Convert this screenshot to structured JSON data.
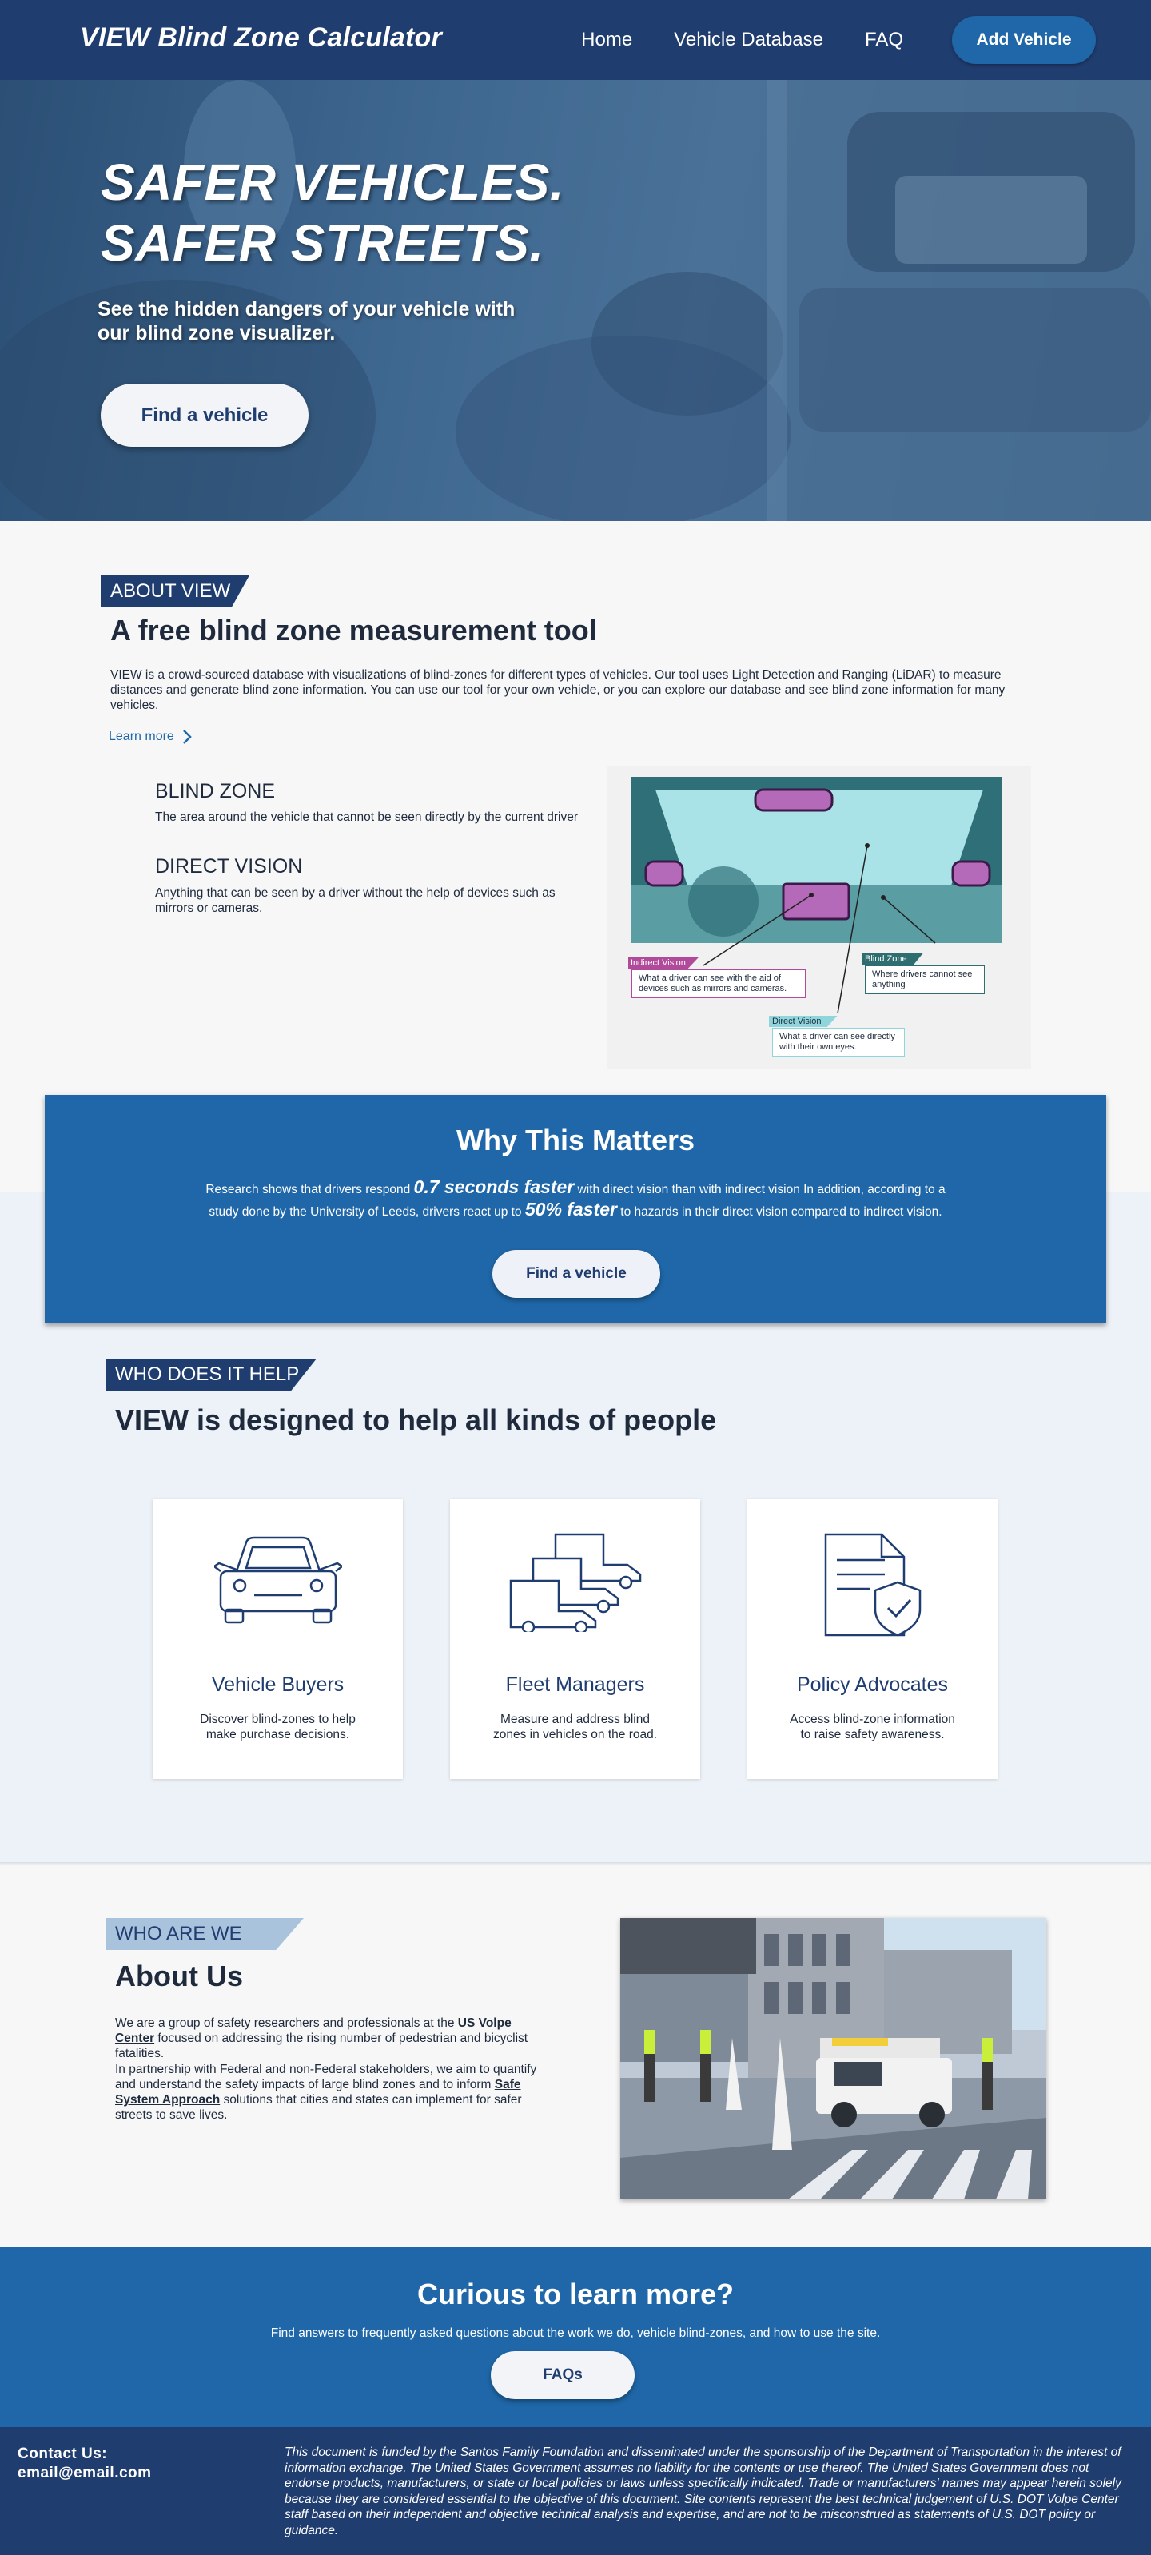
{
  "nav": {
    "brand": "VIEW Blind Zone Calculator",
    "links": [
      "Home",
      "Vehicle Database",
      "FAQ"
    ],
    "add_button": "Add Vehicle"
  },
  "hero": {
    "title_line1": "SAFER VEHICLES.",
    "title_line2": "SAFER STREETS.",
    "subtitle": "See the hidden dangers of your vehicle  with our blind zone visualizer.",
    "button": "Find a vehicle"
  },
  "about_view": {
    "tag": "ABOUT VIEW",
    "title": "A free blind zone measurement tool",
    "text": "VIEW is a crowd-sourced database with visualizations of blind-zones for different types of vehicles. Our tool uses Light Detection and Ranging (LiDAR) to measure distances and generate blind zone information. You can use our tool for your own vehicle, or you can explore our database and see blind zone information for many vehicles.",
    "learn_more": "Learn more",
    "blind_zone_heading": "BLIND ZONE",
    "blind_zone_text": "The area around the vehicle that cannot be seen directly by the current driver",
    "direct_vision_heading": "DIRECT VISION",
    "direct_vision_text": "Anything that can be seen by a driver without the help of devices such as mirrors or cameras.",
    "diagram": {
      "indirect_label": "Indirect Vision",
      "indirect_text": "What a driver can see with the aid of devices such as mirrors and cameras.",
      "blind_label": "Blind Zone",
      "blind_text": "Where drivers cannot see anything",
      "direct_label": "Direct Vision",
      "direct_text": "What a driver can see directly with their own eyes."
    }
  },
  "why": {
    "title": "Why This Matters",
    "l1_a": "Research shows that drivers respond ",
    "l1_b": "0.7 seconds faster",
    "l1_c": " with direct vision than with indirect vision In addition, according to a",
    "l2_a": "study done by the University of Leeds, drivers react up to ",
    "l2_b": "50% faster",
    "l2_c": " to hazards in their direct vision compared to indirect vision.",
    "button": "Find a vehicle"
  },
  "who_helps": {
    "tag": "WHO DOES IT HELP",
    "title": "VIEW is designed to help all kinds of people",
    "cards": [
      {
        "title": "Vehicle Buyers",
        "text": "Discover blind-zones to help make purchase decisions.",
        "icon": "car-icon"
      },
      {
        "title": "Fleet Managers",
        "text": "Measure and address blind zones in vehicles on the road.",
        "icon": "trucks-icon"
      },
      {
        "title": "Policy Advocates",
        "text": "Access blind-zone information to raise safety awareness.",
        "icon": "document-shield-icon"
      }
    ]
  },
  "about_us": {
    "tag": "WHO ARE WE",
    "title": "About Us",
    "p1_a": "We are a group of safety researchers and professionals at the ",
    "p1_link": "US Volpe Center",
    "p1_b": " focused on addressing the rising number of pedestrian and bicyclist fatalities.",
    "p2_a": "In partnership with Federal and non-Federal stakeholders, we aim to quantify and understand the safety impacts of large blind zones and to inform ",
    "p2_link": "Safe System Approach",
    "p2_b": " solutions that cities and states can implement for safer streets to save lives."
  },
  "curious": {
    "title": "Curious to learn more?",
    "text": "Find answers to frequently asked questions about the work we do, vehicle blind-zones, and how to use the site.",
    "button": "FAQs"
  },
  "footer": {
    "contact_label": "Contact Us:",
    "email": "email@email.com",
    "disclaimer": "This document is funded by the Santos Family Foundation and disseminated under the sponsorship of the Department of Transportation in the interest of information exchange. The United States Government assumes no liability for the contents or use thereof. The United States Government does not endorse products, manufacturers, or state or local policies or laws unless specifically indicated. Trade or manufacturers' names may appear herein solely because they are considered essential to the objective of this document. Site contents represent the best technical judgement of U.S. DOT Volpe Center staff based on their independent and objective technical analysis and expertise, and are not to be misconstrued as statements of U.S. DOT policy or guidance."
  },
  "colors": {
    "nav": "#203d70",
    "accent": "#1f67a8",
    "light_bg": "#edf2f8",
    "indirect": "#b14a9b",
    "blind": "#2e6e70",
    "direct": "#8fd6dc"
  }
}
